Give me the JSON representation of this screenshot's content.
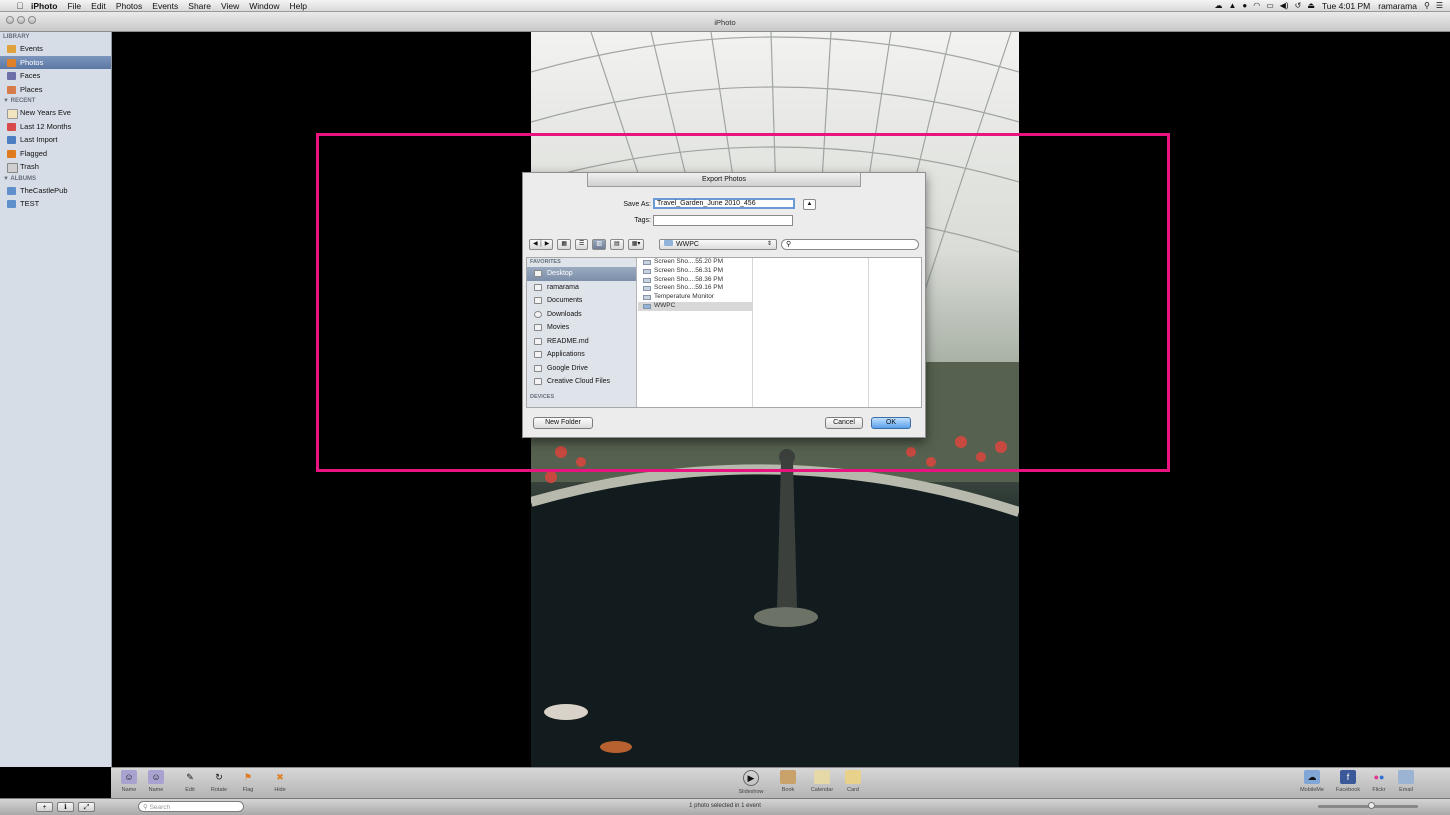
{
  "menubar": {
    "app": "iPhoto",
    "items": [
      "File",
      "Edit",
      "Photos",
      "Events",
      "Share",
      "View",
      "Window",
      "Help"
    ],
    "clock": "Tue 4:01 PM",
    "user": "ramarama"
  },
  "window": {
    "title": "iPhoto"
  },
  "sidebar": {
    "library_header": "LIBRARY",
    "library": [
      {
        "label": "Events",
        "color": "#e0a23a"
      },
      {
        "label": "Photos",
        "color": "#e0802a"
      },
      {
        "label": "Faces",
        "color": "#6d6fa8"
      },
      {
        "label": "Places",
        "color": "#d77b4a"
      }
    ],
    "recent_header": "▼ RECENT",
    "recent": [
      {
        "label": "New Years Eve",
        "color": "#f1e5c0"
      },
      {
        "label": "Last 12 Months",
        "color": "#d94a4a"
      },
      {
        "label": "Last Import",
        "color": "#4b7fc2"
      },
      {
        "label": "Flagged",
        "color": "#e07a1e"
      },
      {
        "label": "Trash",
        "color": "#cfcfcf"
      }
    ],
    "albums_header": "▼ ALBUMS",
    "albums": [
      {
        "label": "TheCastlePub",
        "color": "#5f90cc"
      },
      {
        "label": "TEST",
        "color": "#5f90cc"
      }
    ]
  },
  "dialog": {
    "title": "Export Photos",
    "save_as_label": "Save As:",
    "save_as_value": "Travel_Garden_June 2010_456",
    "tags_label": "Tags:",
    "tags_value": "",
    "location": "WWPC",
    "search_placeholder": "",
    "favorites_header": "FAVORITES",
    "favorites": [
      "Desktop",
      "ramarama",
      "Documents",
      "Downloads",
      "Movies",
      "README.md",
      "Applications",
      "Google Drive",
      "Creative Cloud Files"
    ],
    "devices_header": "DEVICES",
    "files": [
      "Screen Sho....55.20 PM",
      "Screen Sho....56.31 PM",
      "Screen Sho....58.36 PM",
      "Screen Sho....59.16 PM",
      "Temperature Monitor",
      "WWPC"
    ],
    "new_folder": "New Folder",
    "cancel": "Cancel",
    "ok": "OK"
  },
  "toolbar": {
    "left": [
      "Name",
      "Name",
      "Edit",
      "Rotate",
      "Flag",
      "Hide"
    ],
    "center": [
      "Slideshow",
      "Book",
      "Calendar",
      "Card"
    ],
    "right": [
      "MobileMe",
      "Facebook",
      "Flickr",
      "Email"
    ]
  },
  "statusbar": {
    "search_placeholder": "Search",
    "status": "1 photo selected in 1 event"
  },
  "highlight_color": "#e8137e"
}
